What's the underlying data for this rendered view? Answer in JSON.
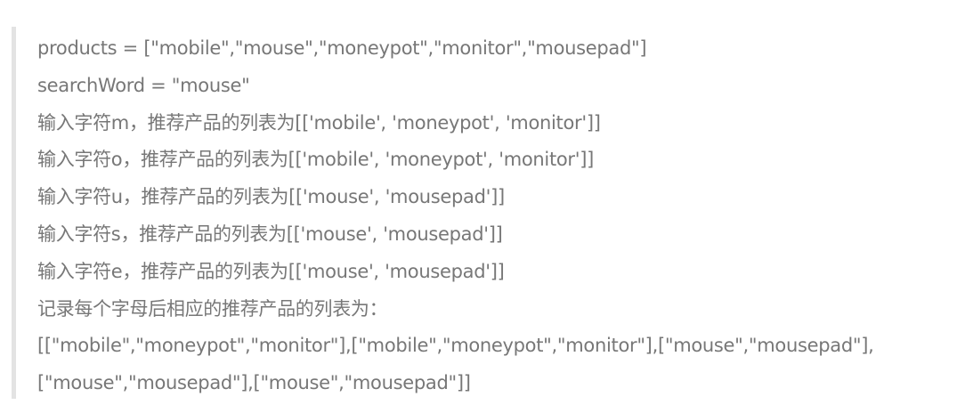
{
  "blockquote": {
    "lines": [
      "products = [\"mobile\",\"mouse\",\"moneypot\",\"monitor\",\"mousepad\"]",
      "searchWord = \"mouse\"",
      "输入字符m，推荐产品的列表为[['mobile', 'moneypot', 'monitor']]",
      "输入字符o，推荐产品的列表为[['mobile', 'moneypot', 'monitor']]",
      "输入字符u，推荐产品的列表为[['mouse', 'mousepad']]",
      "输入字符s，推荐产品的列表为[['mouse', 'mousepad']]",
      "输入字符e，推荐产品的列表为[['mouse', 'mousepad']]",
      "记录每个字母后相应的推荐产品的列表为：",
      "[[\"mobile\",\"moneypot\",\"monitor\"],[\"mobile\",\"moneypot\",\"monitor\"],[\"mouse\",\"mousepad\"],",
      "[\"mouse\",\"mousepad\"],[\"mouse\",\"mousepad\"]]"
    ]
  }
}
